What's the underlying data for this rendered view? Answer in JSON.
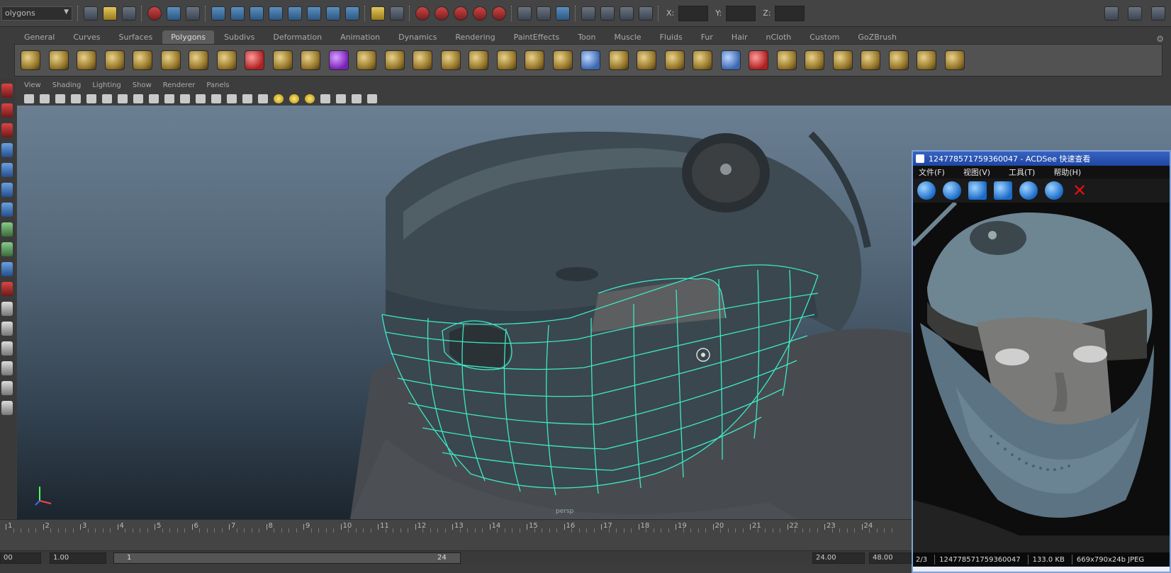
{
  "status_line": {
    "menu_set": "olygons",
    "xyz_labels": [
      "X:",
      "Y:",
      "Z:"
    ]
  },
  "shelf_tabs": [
    "General",
    "Curves",
    "Surfaces",
    "Polygons",
    "Subdivs",
    "Deformation",
    "Animation",
    "Dynamics",
    "Rendering",
    "PaintEffects",
    "Toon",
    "Muscle",
    "Fluids",
    "Fur",
    "Hair",
    "nCloth",
    "Custom",
    "GoZBrush"
  ],
  "active_tab": "Polygons",
  "panel_menu": [
    "View",
    "Shading",
    "Lighting",
    "Show",
    "Renderer",
    "Panels"
  ],
  "viewport": {
    "camera_label": "persp"
  },
  "time_slider": {
    "ticks": [
      "1",
      "2",
      "3",
      "4",
      "5",
      "6",
      "7",
      "8",
      "9",
      "10",
      "11",
      "12",
      "13",
      "14",
      "15",
      "16",
      "17",
      "18",
      "19",
      "20",
      "21",
      "22",
      "23",
      "24"
    ]
  },
  "range_slider": {
    "start_time": "00",
    "playback_start": "1.00",
    "range_start_label": "1",
    "range_end_label": "24",
    "playback_end": "24.00",
    "end_time": "48.00"
  },
  "acdsee": {
    "title": "124778571759360047 - ACDSee 快速查看",
    "menu": [
      "文件(F)",
      "视图(V)",
      "工具(T)",
      "帮助(H)"
    ],
    "status": {
      "index": "2/3",
      "filename": "124778571759360047",
      "size": "133.0 KB",
      "dims": "669x790x24b JPEG"
    }
  },
  "colors": {
    "wire": "#3ee8c4",
    "helmet": "#3d4a52",
    "viewport_top": "#6b7f93",
    "viewport_bottom": "#1c252e"
  }
}
